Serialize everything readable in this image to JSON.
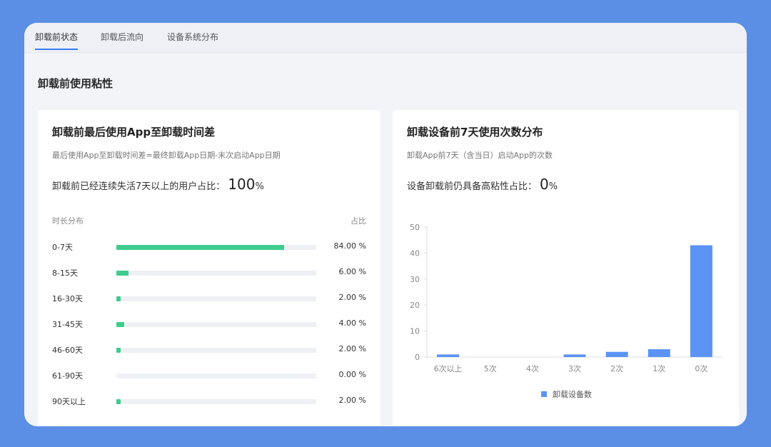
{
  "tabs": [
    {
      "label": "卸载前状态",
      "active": true
    },
    {
      "label": "卸载后流向",
      "active": false
    },
    {
      "label": "设备系统分布",
      "active": false
    }
  ],
  "section_title": "卸载前使用粘性",
  "left_card": {
    "title": "卸载前最后使用App至卸载时间差",
    "subtitle": "最后使用App至卸载时间差=最终卸载App日期-末次启动App日期",
    "stat_label": "卸载前已经连续失活7天以上的用户占比：",
    "stat_value": "100",
    "stat_unit": "%",
    "col_left": "时长分布",
    "col_right": "占比",
    "rows": [
      {
        "label": "0-7天",
        "value": "84.00 %",
        "percent": 84
      },
      {
        "label": "8-15天",
        "value": "6.00 %",
        "percent": 6
      },
      {
        "label": "16-30天",
        "value": "2.00 %",
        "percent": 2
      },
      {
        "label": "31-45天",
        "value": "4.00 %",
        "percent": 4
      },
      {
        "label": "46-60天",
        "value": "2.00 %",
        "percent": 2
      },
      {
        "label": "61-90天",
        "value": "0.00 %",
        "percent": 0
      },
      {
        "label": "90天以上",
        "value": "2.00 %",
        "percent": 2
      }
    ],
    "accent_color": "#3ecc8f"
  },
  "right_card": {
    "title": "卸载设备前7天使用次数分布",
    "subtitle": "卸载App前7天（含当日）启动App的次数",
    "stat_label": "设备卸载前仍具备高粘性占比：",
    "stat_value": "0",
    "stat_unit": "%"
  },
  "chart_data": {
    "type": "bar",
    "categories": [
      "6次以上",
      "5次",
      "4次",
      "3次",
      "2次",
      "1次",
      "0次"
    ],
    "series": [
      {
        "name": "卸载设备数",
        "values": [
          1,
          0,
          0,
          1,
          2,
          3,
          43
        ],
        "color": "#5b93f5"
      }
    ],
    "yticks": [
      0,
      10,
      20,
      30,
      40,
      50
    ],
    "ylim": [
      0,
      50
    ],
    "legend_position": "bottom",
    "grid": false
  }
}
